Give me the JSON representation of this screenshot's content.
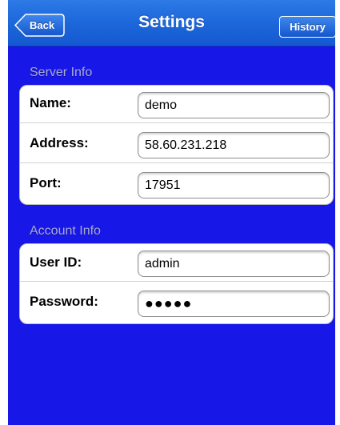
{
  "navigation": {
    "title": "Settings",
    "back_label": "Back",
    "history_label": "History"
  },
  "server_info": {
    "header": "Server Info",
    "rows": [
      {
        "label": "Name:",
        "value": "demo"
      },
      {
        "label": "Address:",
        "value": "58.60.231.218"
      },
      {
        "label": "Port:",
        "value": "17951"
      }
    ]
  },
  "account_info": {
    "header": "Account Info",
    "rows": [
      {
        "label": "User ID:",
        "value": "admin"
      },
      {
        "label": "Password:",
        "value": "●●●●●"
      }
    ]
  },
  "colors": {
    "background_blue": "#1717e8",
    "navigation_blue": "#1d68db"
  }
}
